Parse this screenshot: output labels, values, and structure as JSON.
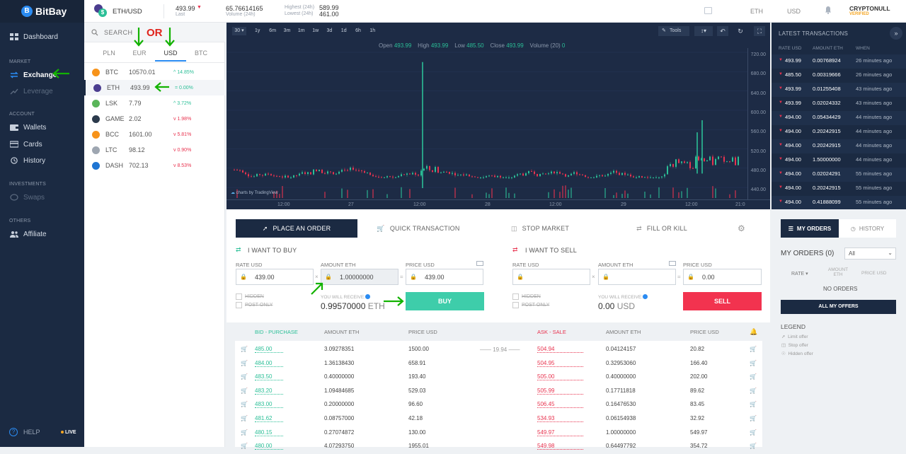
{
  "sidebar": {
    "brand": "BitBay",
    "sections": {
      "market": "MARKET",
      "account": "ACCOUNT",
      "investments": "INVESTMENTS",
      "others": "OTHERS"
    },
    "items": {
      "dashboard": "Dashboard",
      "exchange": "Exchange",
      "leverage": "Leverage",
      "wallets": "Wallets",
      "cards": "Cards",
      "history": "History",
      "swaps": "Swaps",
      "affiliate": "Affiliate"
    },
    "help": "HELP",
    "live": "LIVE"
  },
  "topbar": {
    "pair": "ETH/USD",
    "last_value": "493.99",
    "last_label": "Last",
    "volume_value": "65.76614165",
    "volume_label": "Volume (24h)",
    "highest_label": "Highest (24h)",
    "highest_value": "589.99",
    "lowest_label": "Lowest (24h)",
    "lowest_value": "461.00",
    "currency1": "ETH",
    "currency2": "USD",
    "username": "CRYPTONULL",
    "user_status": "VERIFIED"
  },
  "markets": {
    "search_placeholder": "SEARCH",
    "annotation_or": "OR",
    "tabs": [
      "PLN",
      "EUR",
      "USD",
      "BTC"
    ],
    "rows": [
      {
        "sym": "BTC",
        "price": "10570.01",
        "change": "14.85%",
        "dir": "up",
        "color": "#f7931a"
      },
      {
        "sym": "ETH",
        "price": "493.99",
        "change": "0.00%",
        "dir": "flat",
        "color": "#4b3d8f"
      },
      {
        "sym": "LSK",
        "price": "7.79",
        "change": "3.72%",
        "dir": "up",
        "color": "#5ab55a"
      },
      {
        "sym": "GAME",
        "price": "2.02",
        "change": "1.98%",
        "dir": "dn",
        "color": "#2b3a4c"
      },
      {
        "sym": "BCC",
        "price": "1601.00",
        "change": "5.81%",
        "dir": "dn",
        "color": "#f7931a"
      },
      {
        "sym": "LTC",
        "price": "98.12",
        "change": "0.90%",
        "dir": "dn",
        "color": "#9ea6b1"
      },
      {
        "sym": "DASH",
        "price": "702.13",
        "change": "8.53%",
        "dir": "dn",
        "color": "#1e75d3"
      }
    ]
  },
  "chart": {
    "interval": "30",
    "ranges": [
      "1y",
      "6m",
      "3m",
      "1m",
      "1w",
      "3d",
      "1d",
      "6h",
      "1h"
    ],
    "tools": "Tools",
    "ohlc": {
      "open_label": "Open",
      "open": "493.99",
      "high_label": "High",
      "high": "493.99",
      "low_label": "Low",
      "low": "485.50",
      "close_label": "Close",
      "close": "493.99",
      "volume_label": "Volume (20)",
      "volume": "0"
    },
    "y_ticks": [
      "720.00",
      "680.00",
      "640.00",
      "600.00",
      "560.00",
      "520.00",
      "480.00",
      "440.00"
    ],
    "x_ticks": [
      "12:00",
      "27",
      "12:00",
      "28",
      "12:00",
      "29",
      "12:00",
      "21:0"
    ],
    "credit": "charts by TradingView"
  },
  "latest": {
    "title": "LATEST TRANSACTIONS",
    "cols": [
      "RATE USD",
      "AMOUNT ETH",
      "WHEN"
    ],
    "rows": [
      {
        "rate": "493.99",
        "amount": "0.00768924",
        "when": "26 minutes ago"
      },
      {
        "rate": "485.50",
        "amount": "0.00319666",
        "when": "26 minutes ago"
      },
      {
        "rate": "493.99",
        "amount": "0.01255408",
        "when": "43 minutes ago"
      },
      {
        "rate": "493.99",
        "amount": "0.02024332",
        "when": "43 minutes ago"
      },
      {
        "rate": "494.00",
        "amount": "0.05434429",
        "when": "44 minutes ago"
      },
      {
        "rate": "494.00",
        "amount": "0.20242915",
        "when": "44 minutes ago"
      },
      {
        "rate": "494.00",
        "amount": "0.20242915",
        "when": "44 minutes ago"
      },
      {
        "rate": "494.00",
        "amount": "1.50000000",
        "when": "44 minutes ago"
      },
      {
        "rate": "494.00",
        "amount": "0.02024291",
        "when": "55 minutes ago"
      },
      {
        "rate": "494.00",
        "amount": "0.20242915",
        "when": "55 minutes ago"
      },
      {
        "rate": "494.00",
        "amount": "0.41888099",
        "when": "55 minutes ago"
      }
    ]
  },
  "order": {
    "tabs": [
      "PLACE AN ORDER",
      "QUICK TRANSACTION",
      "STOP MARKET",
      "FILL OR KILL"
    ],
    "buy": {
      "title": "I WANT TO BUY",
      "rate_label": "RATE USD",
      "rate_value": "439.00",
      "amount_label": "AMOUNT ETH",
      "amount_value": "1.00000000",
      "price_label": "PRICE USD",
      "price_value": "439.00",
      "hidden": "HIDDEN",
      "post_only": "POST ONLY",
      "receive_label": "YOU WILL RECEIVE:",
      "receive_value": "0.99570000",
      "receive_unit": "ETH",
      "button": "BUY"
    },
    "sell": {
      "title": "I WANT TO SELL",
      "rate_label": "RATE USD",
      "rate_value": "",
      "amount_label": "AMOUNT ETH",
      "amount_value": "",
      "price_label": "PRICE USD",
      "price_value": "0.00",
      "hidden": "HIDDEN",
      "post_only": "POST ONLY",
      "receive_label": "YOU WILL RECEIVE:",
      "receive_value": "0.00",
      "receive_unit": "USD",
      "button": "SELL"
    }
  },
  "book": {
    "headers": {
      "bid": "BID - PURCHASE",
      "bid_amount": "AMOUNT ETH",
      "bid_price": "PRICE USD",
      "ask": "ASK - SALE",
      "ask_amount": "AMOUNT ETH",
      "ask_price": "PRICE USD"
    },
    "spread": "19.94",
    "rows": [
      {
        "bid": "485.00",
        "bamt": "3.09278351",
        "bprice": "1500.00",
        "ask": "504.94",
        "aamt": "0.04124157",
        "aprice": "20.82"
      },
      {
        "bid": "484.00",
        "bamt": "1.36138430",
        "bprice": "658.91",
        "ask": "504.95",
        "aamt": "0.32953060",
        "aprice": "166.40"
      },
      {
        "bid": "483.50",
        "bamt": "0.40000000",
        "bprice": "193.40",
        "ask": "505.00",
        "aamt": "0.40000000",
        "aprice": "202.00"
      },
      {
        "bid": "483.20",
        "bamt": "1.09484685",
        "bprice": "529.03",
        "ask": "505.99",
        "aamt": "0.17711818",
        "aprice": "89.62"
      },
      {
        "bid": "483.00",
        "bamt": "0.20000000",
        "bprice": "96.60",
        "ask": "506.45",
        "aamt": "0.16476530",
        "aprice": "83.45"
      },
      {
        "bid": "481.62",
        "bamt": "0.08757000",
        "bprice": "42.18",
        "ask": "534.93",
        "aamt": "0.06154938",
        "aprice": "32.92"
      },
      {
        "bid": "480.15",
        "bamt": "0.27074872",
        "bprice": "130.00",
        "ask": "549.97",
        "aamt": "1.00000000",
        "aprice": "549.97"
      },
      {
        "bid": "480.00",
        "bamt": "4.07293750",
        "bprice": "1955.01",
        "ask": "549.98",
        "aamt": "0.64497792",
        "aprice": "354.72"
      }
    ]
  },
  "myorders": {
    "tab_active": "MY ORDERS",
    "tab_history": "HISTORY",
    "title": "MY ORDERS (0)",
    "filter": "All",
    "cols": [
      "RATE",
      "AMOUNT ETH",
      "PRICE USD"
    ],
    "empty": "NO ORDERS",
    "all_button": "ALL MY OFFERS",
    "legend_title": "LEGEND",
    "legend": [
      "Limit offer",
      "Stop offer",
      "Hidden offer"
    ]
  }
}
